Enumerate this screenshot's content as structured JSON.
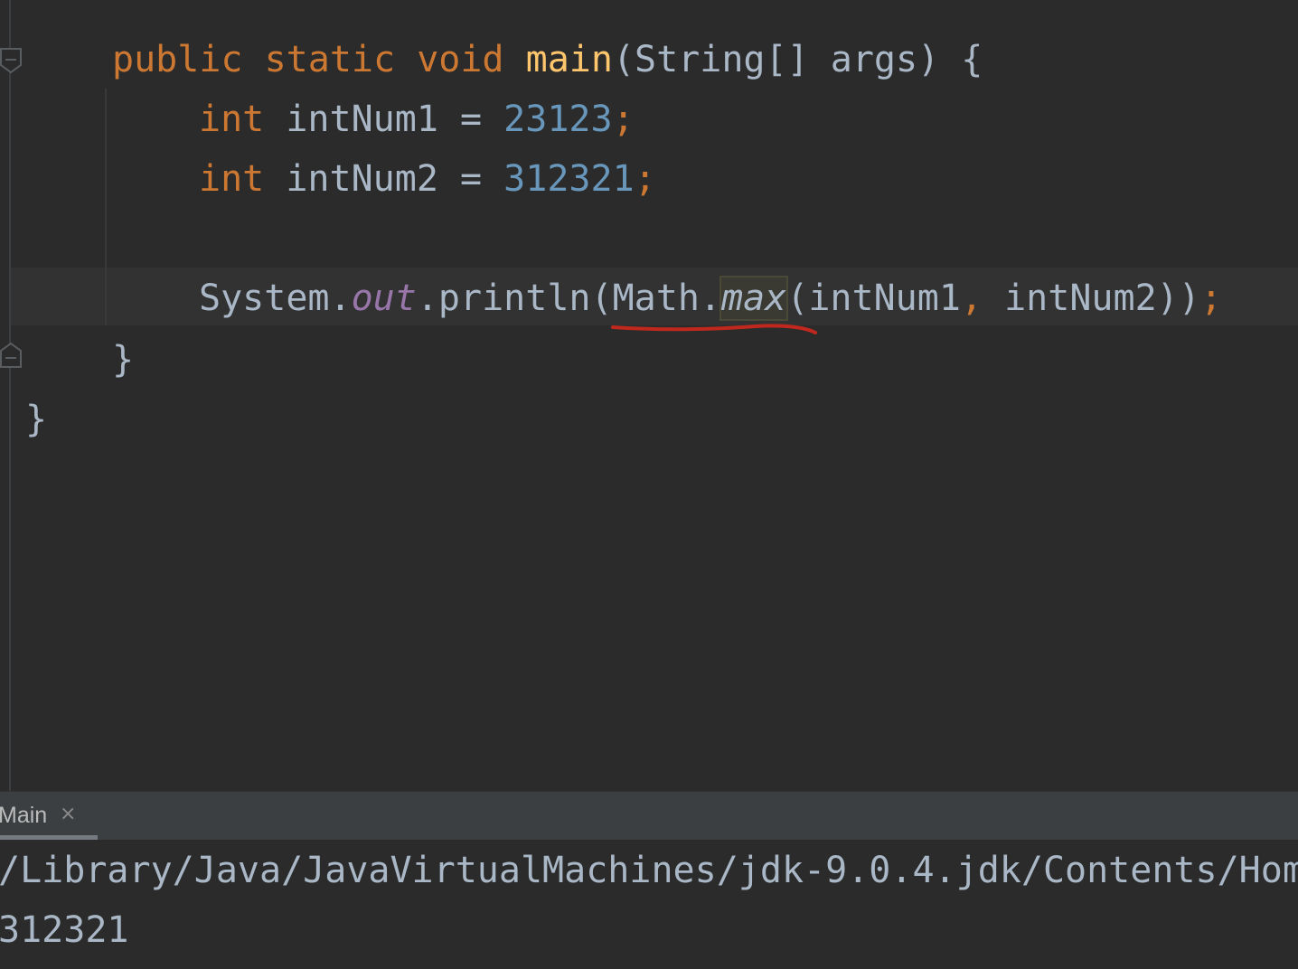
{
  "editor": {
    "lines": {
      "main_sig": {
        "kw_public": "public",
        "kw_static": "static",
        "kw_void": "void",
        "fn_name": "main",
        "params": "(String[] args) {"
      },
      "decl1": {
        "type": "int",
        "var": "intNum1",
        "eq": " = ",
        "value": "23123",
        "semi": ";"
      },
      "decl2": {
        "type": "int",
        "var": "intNum2",
        "eq": " = ",
        "value": "312321",
        "semi": ";"
      },
      "println": {
        "system": "System.",
        "out": "out",
        "println": ".println(",
        "math": "Math.",
        "max": "max",
        "args_open": "(intNum1",
        "comma": ",",
        "args_rest": " intNum2))",
        "semi": ";"
      },
      "close_method": "}",
      "close_class": "}"
    }
  },
  "console": {
    "tab_label": "Main",
    "close_glyph": "×",
    "output_lines": [
      "/Library/Java/JavaVirtualMachines/jdk-9.0.4.jdk/Contents/Hom",
      "312321"
    ]
  },
  "colors": {
    "background": "#2b2b2b",
    "keyword": "#cc7832",
    "method_decl": "#ffc66d",
    "number": "#6897bb",
    "static_field": "#9876aa",
    "default_text": "#a9b7c6",
    "annotation_underline": "#c0281e"
  }
}
